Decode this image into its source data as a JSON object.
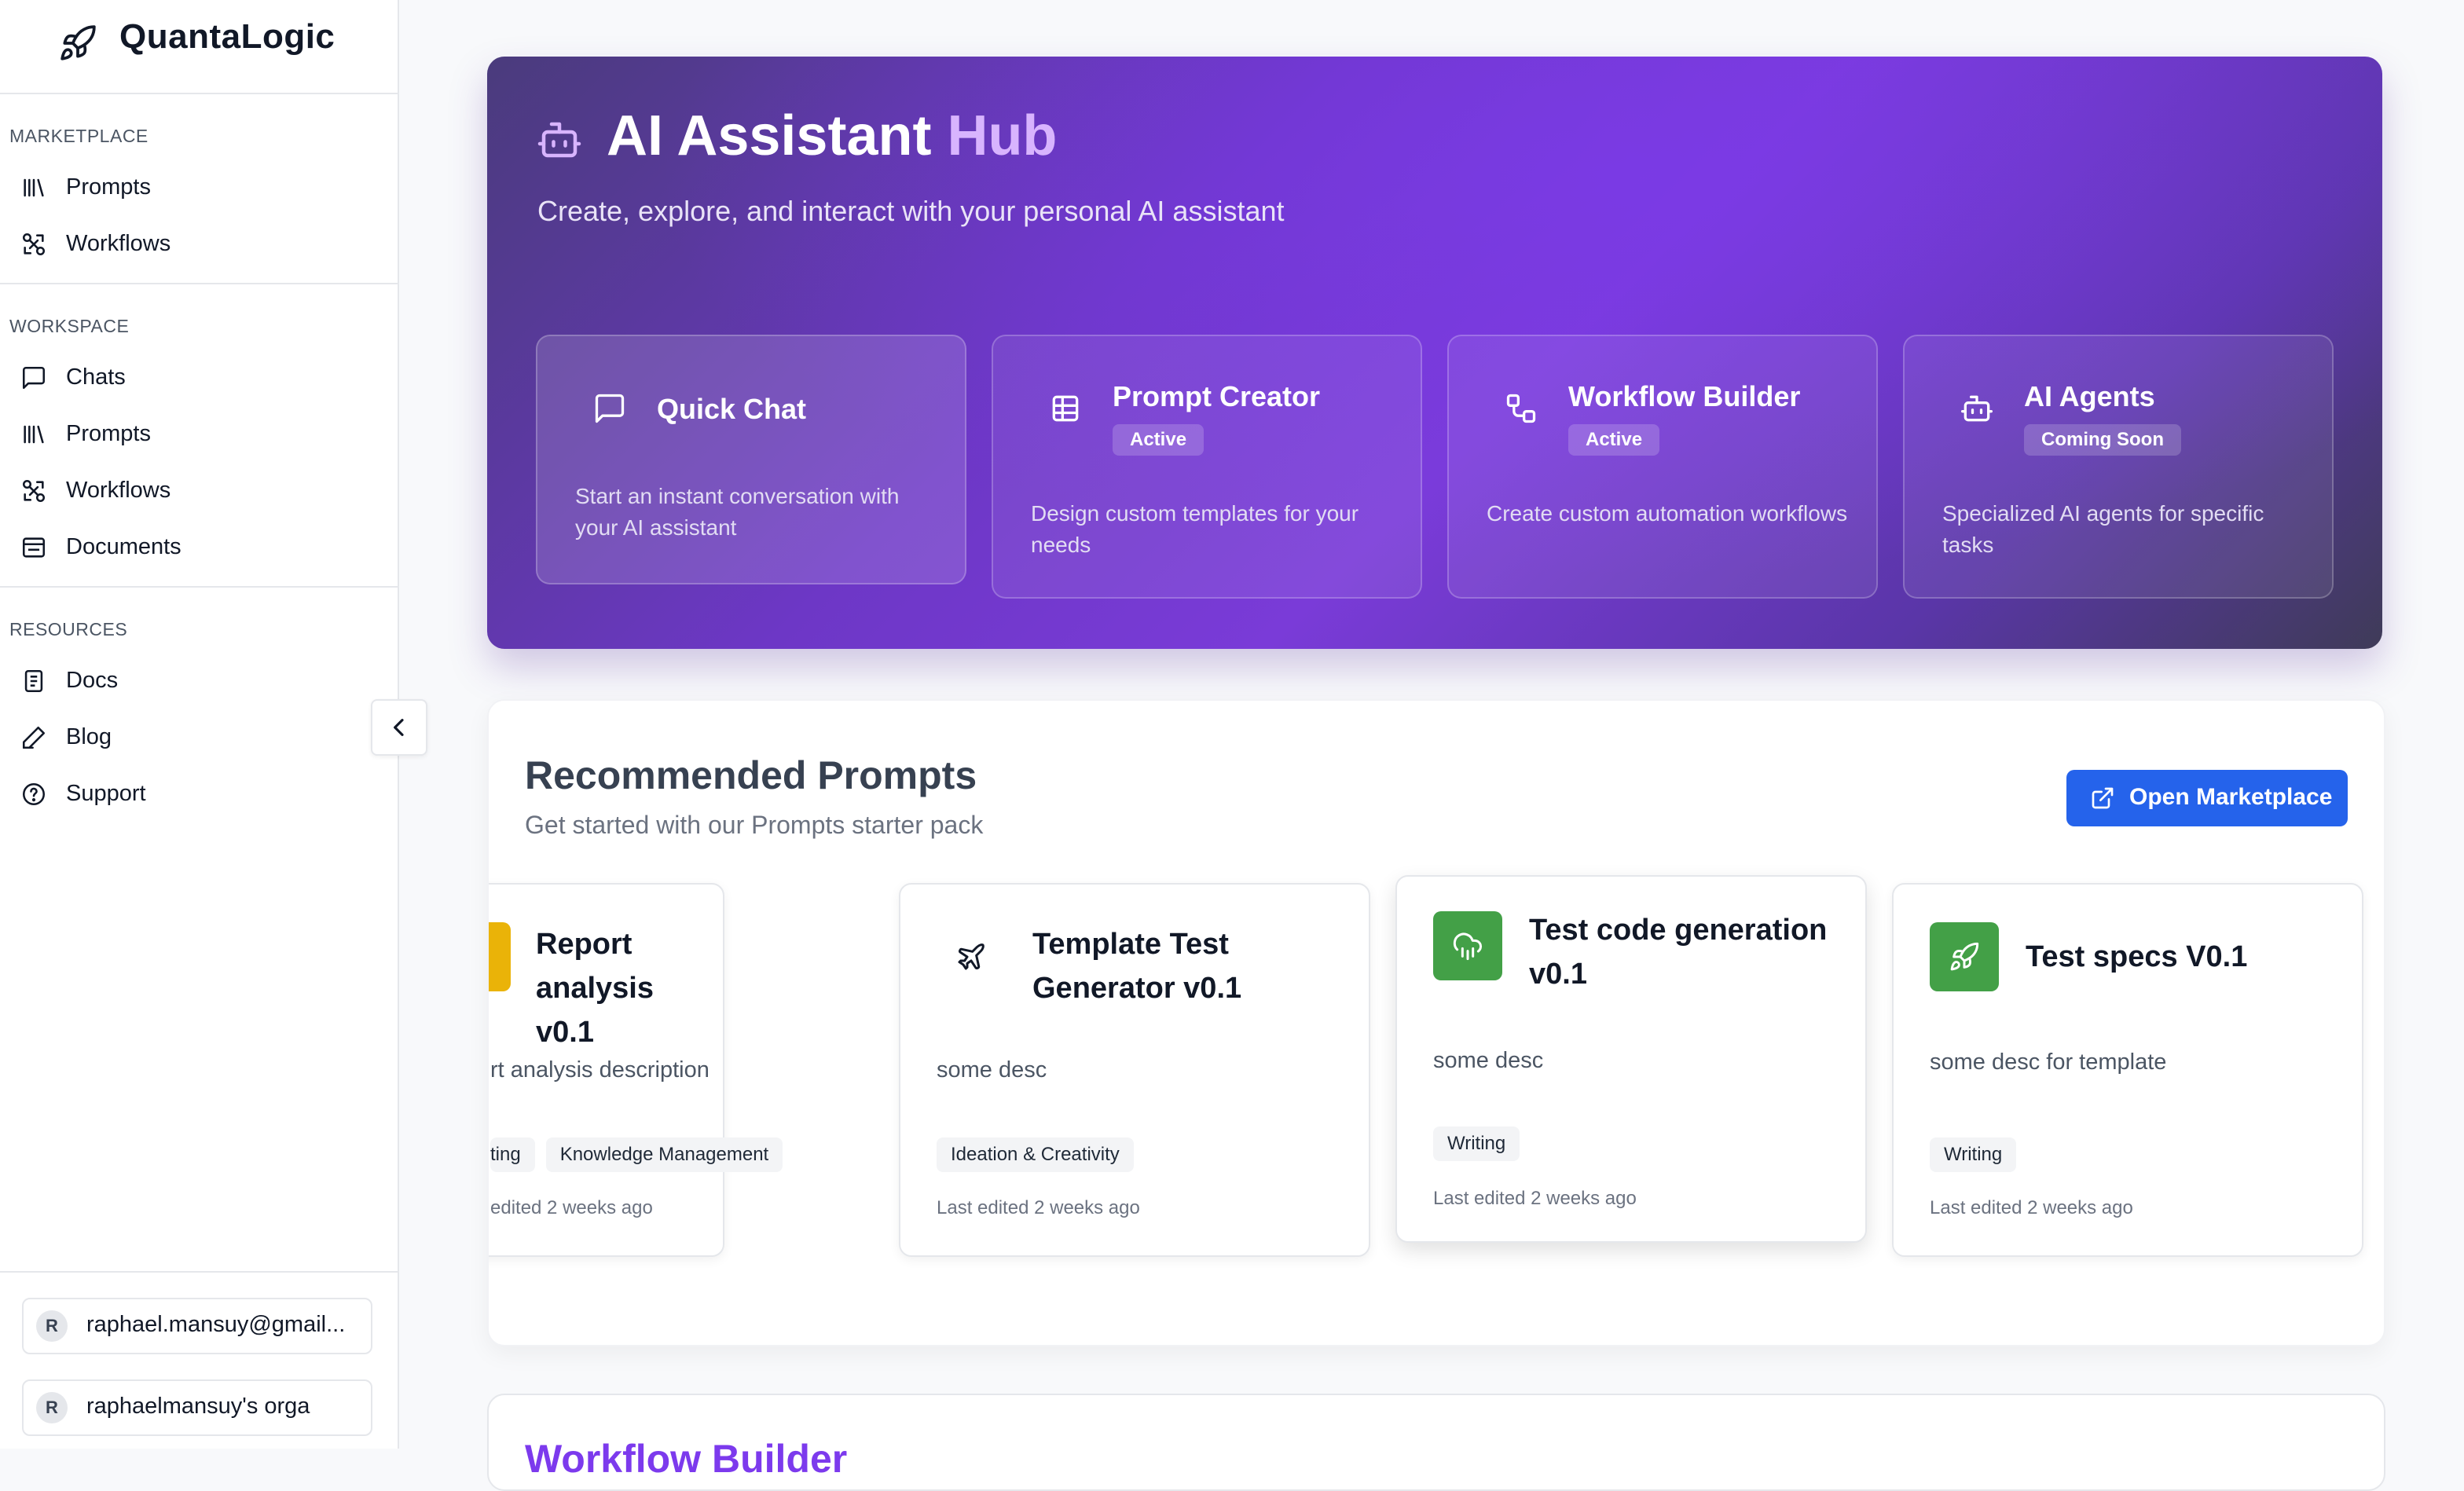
{
  "brand": {
    "name": "QuantaLogic"
  },
  "sidebar": {
    "sections": [
      {
        "label": "MARKETPLACE",
        "items": [
          {
            "label": "Prompts"
          },
          {
            "label": "Workflows"
          }
        ]
      },
      {
        "label": "WORKSPACE",
        "items": [
          {
            "label": "Chats"
          },
          {
            "label": "Prompts"
          },
          {
            "label": "Workflows"
          },
          {
            "label": "Documents"
          }
        ]
      },
      {
        "label": "RESOURCES",
        "items": [
          {
            "label": "Docs"
          },
          {
            "label": "Blog"
          },
          {
            "label": "Support"
          }
        ]
      }
    ],
    "accounts": [
      {
        "initial": "R",
        "name": "raphael.mansuy@gmail..."
      },
      {
        "initial": "R",
        "name": "raphaelmansuy's orga"
      }
    ]
  },
  "hero": {
    "title_plain": "AI Assistant ",
    "title_accent": "Hub",
    "subtitle": "Create, explore, and interact with your personal AI assistant",
    "cards": [
      {
        "title": "Quick Chat",
        "badge": "",
        "description": "Start an instant conversation with your AI assistant",
        "icon": "message-square-icon"
      },
      {
        "title": "Prompt Creator",
        "badge": "Active",
        "description": "Design custom templates for your needs",
        "icon": "grid-table-icon"
      },
      {
        "title": "Workflow Builder",
        "badge": "Active",
        "description": "Create custom automation workflows",
        "icon": "workflow-icon"
      },
      {
        "title": "AI Agents",
        "badge": "Coming Soon",
        "description": "Specialized AI agents for specific tasks",
        "icon": "bot-icon"
      }
    ]
  },
  "recommended": {
    "title": "Recommended Prompts",
    "subtitle": "Get started with our Prompts starter pack",
    "button_label": "Open Marketplace",
    "cards": [
      {
        "title": "Report analysis v0.1",
        "description": "rt analysis description",
        "tags": [
          "ting",
          "Knowledge Management"
        ],
        "edited": "edited 2 weeks ago",
        "icon_color": "#eab308"
      },
      {
        "title": "Template Test Generator v0.1",
        "description": "some desc",
        "tags": [
          "Ideation & Creativity"
        ],
        "edited": "Last edited 2 weeks ago",
        "icon_color": "#ffffff"
      },
      {
        "title": "Test code generation v0.1",
        "description": "some desc",
        "tags": [
          "Writing"
        ],
        "edited": "Last edited 2 weeks ago",
        "icon_color": "#43a047"
      },
      {
        "title": "Test specs V0.1",
        "description": "some desc for template",
        "tags": [
          "Writing"
        ],
        "edited": "Last edited 2 weeks ago",
        "icon_color": "#43a047"
      }
    ]
  },
  "next_section": {
    "title": "Workflow Builder"
  },
  "colors": {
    "accent": "#7c3aed",
    "primary_button": "#2563eb",
    "success": "#43a047"
  }
}
